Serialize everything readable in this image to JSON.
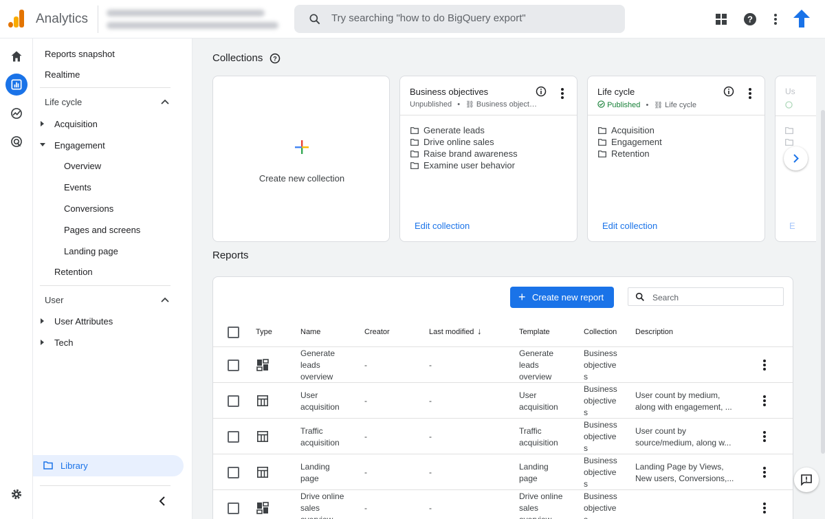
{
  "app": {
    "brand": "Analytics"
  },
  "search": {
    "placeholder": "Try searching \"how to do BigQuery export\""
  },
  "nav": {
    "reports_snapshot": "Reports snapshot",
    "realtime": "Realtime",
    "lifecycle_heading": "Life cycle",
    "acquisition": "Acquisition",
    "engagement": "Engagement",
    "engagement_children": [
      "Overview",
      "Events",
      "Conversions",
      "Pages and screens",
      "Landing page"
    ],
    "retention": "Retention",
    "user_heading": "User",
    "user_attributes": "User Attributes",
    "tech": "Tech",
    "library": "Library"
  },
  "collections": {
    "title": "Collections",
    "create_label": "Create new collection",
    "cards": [
      {
        "title": "Business objectives",
        "status": "Unpublished",
        "template": "Business object…",
        "items": [
          "Generate leads",
          "Drive online sales",
          "Raise brand awareness",
          "Examine user behavior"
        ],
        "edit": "Edit collection"
      },
      {
        "title": "Life cycle",
        "status": "Published",
        "template": "Life cycle",
        "items": [
          "Acquisition",
          "Engagement",
          "Retention"
        ],
        "edit": "Edit collection"
      }
    ],
    "partial_card": {
      "title": "Us",
      "edit": "E"
    }
  },
  "reports": {
    "title": "Reports",
    "create_button": "Create new report",
    "search_placeholder": "Search",
    "columns": [
      "Type",
      "Name",
      "Creator",
      "Last modified",
      "Template",
      "Collection",
      "Description"
    ],
    "sort_indicator": "↓",
    "rows": [
      {
        "type_icon": "overview-icon",
        "name": [
          "Generate",
          "leads",
          "overview"
        ],
        "creator": "-",
        "modified": "-",
        "template": [
          "Generate",
          "leads",
          "overview"
        ],
        "collection": [
          "Business",
          "objective",
          "s"
        ],
        "description": [
          "",
          ""
        ]
      },
      {
        "type_icon": "detail-icon",
        "name": [
          "User",
          "acquisition"
        ],
        "creator": "-",
        "modified": "-",
        "template": [
          "User",
          "acquisition"
        ],
        "collection": [
          "Business",
          "objective",
          "s"
        ],
        "description": [
          "User count by medium,",
          "along with engagement, ..."
        ]
      },
      {
        "type_icon": "detail-icon",
        "name": [
          "Traffic",
          "acquisition"
        ],
        "creator": "-",
        "modified": "-",
        "template": [
          "Traffic",
          "acquisition"
        ],
        "collection": [
          "Business",
          "objective",
          "s"
        ],
        "description": [
          "User count by",
          "source/medium, along w..."
        ]
      },
      {
        "type_icon": "detail-icon",
        "name": [
          "Landing",
          "page"
        ],
        "creator": "-",
        "modified": "-",
        "template": [
          "Landing",
          "page"
        ],
        "collection": [
          "Business",
          "objective",
          "s"
        ],
        "description": [
          "Landing Page by Views,",
          "New users, Conversions,..."
        ]
      },
      {
        "type_icon": "overview-icon",
        "name": [
          "Drive online",
          "sales",
          "overview"
        ],
        "creator": "-",
        "modified": "-",
        "template": [
          "Drive online",
          "sales",
          "overview"
        ],
        "collection": [
          "Business",
          "objective",
          "s"
        ],
        "description": [
          "",
          ""
        ]
      }
    ]
  },
  "colors": {
    "accent": "#1a73e8",
    "published": "#188038",
    "logo_orange": "#f9ab00",
    "logo_dark": "#e37400"
  }
}
